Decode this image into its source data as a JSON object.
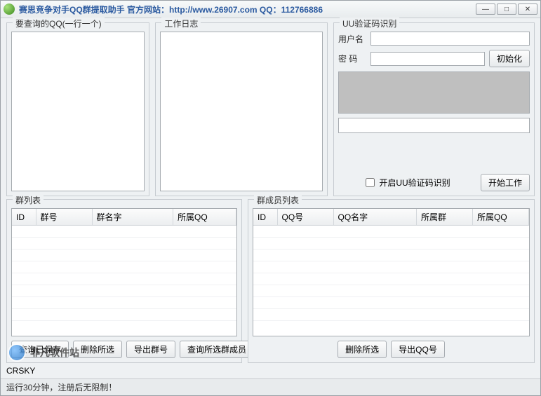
{
  "window": {
    "title": "赛思竞争对手QQ群提取助手 官方网站：http://www.26907.com  QQ：112766886",
    "min": "—",
    "max": "□",
    "close": "✕"
  },
  "query": {
    "legend": "要查询的QQ(一行一个)",
    "value": ""
  },
  "log": {
    "legend": "工作日志",
    "value": ""
  },
  "uu": {
    "legend": "UU验证码识别",
    "user_label": "用户名",
    "user_value": "",
    "pass_label": "密 码",
    "pass_value": "",
    "init_btn": "初始化",
    "captcha_input": "",
    "enable_label": "开启UU验证码识别",
    "start_btn": "开始工作"
  },
  "groups_list": {
    "legend": "群列表",
    "cols": [
      "ID",
      "群号",
      "群名字",
      "所属QQ"
    ],
    "actions": {
      "save_queried": "查询已保存",
      "delete_selected": "删除所选",
      "export_group_id": "导出群号",
      "query_selected_members": "查询所选群成员"
    }
  },
  "members_list": {
    "legend": "群成员列表",
    "cols": [
      "ID",
      "QQ号",
      "QQ名字",
      "所属群",
      "所属QQ"
    ],
    "actions": {
      "delete_selected": "删除所选",
      "export_qq": "导出QQ号"
    }
  },
  "status": {
    "text": "运行30分钟，注册后无限制！"
  },
  "watermark": {
    "site": "非凡软件站",
    "domain": "CRSKY"
  }
}
